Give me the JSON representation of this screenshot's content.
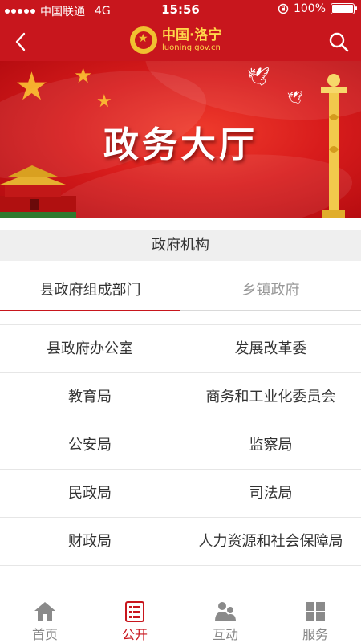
{
  "status_bar": {
    "carrier": "中国联通",
    "network": "4G",
    "time": "15:56",
    "battery_text": "100%",
    "battery_level": 1.0
  },
  "header": {
    "brand_cn": "中国·洛宁",
    "brand_url": "luoning.gov.cn",
    "icons": [
      "back-arrow-icon",
      "search-icon",
      "national-emblem-icon"
    ],
    "bg_color": "#c8161d",
    "brand_color": "#ffd84a"
  },
  "banner": {
    "title": "政务大厅"
  },
  "section": {
    "title": "政府机构"
  },
  "tabs": [
    {
      "label": "县政府组成部门",
      "active": true
    },
    {
      "label": "乡镇政府",
      "active": false
    }
  ],
  "departments": [
    "县政府办公室",
    "发展改革委",
    "教育局",
    "商务和工业化委员会",
    "公安局",
    "监察局",
    "民政局",
    "司法局",
    "财政局",
    "人力资源和社会保障局"
  ],
  "nav": [
    {
      "label": "首页",
      "icon": "home-icon",
      "active": false
    },
    {
      "label": "公开",
      "icon": "list-doc-icon",
      "active": true
    },
    {
      "label": "互动",
      "icon": "people-icon",
      "active": false
    },
    {
      "label": "服务",
      "icon": "grid-icon",
      "active": false
    }
  ],
  "colors": {
    "accent": "#c8161d",
    "inactive_text": "#888888"
  }
}
